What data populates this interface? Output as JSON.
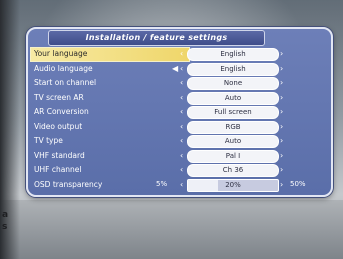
{
  "title": "Installation / feature settings",
  "rows": [
    {
      "label": "Your language",
      "value": "English",
      "selected": true
    },
    {
      "label": "Audio language",
      "value": "English",
      "icon": "speaker-icon"
    },
    {
      "label": "Start on channel",
      "value": "None"
    },
    {
      "label": "TV screen AR",
      "value": "Auto"
    },
    {
      "label": "AR Conversion",
      "value": "Full screen"
    },
    {
      "label": "Video output",
      "value": "RGB"
    },
    {
      "label": "TV type",
      "value": "Auto"
    },
    {
      "label": "VHF standard",
      "value": "Pal I"
    },
    {
      "label": "UHF channel",
      "value": "Ch 36"
    }
  ],
  "osd": {
    "label": "OSD transparency",
    "min_label": "5%",
    "max_label": "50%",
    "value_label": "20%",
    "fill_fraction": 0.33
  },
  "colors": {
    "panel": "#6579b3",
    "highlight": "#f2dc7c",
    "value_box": "#f3f4f8"
  }
}
